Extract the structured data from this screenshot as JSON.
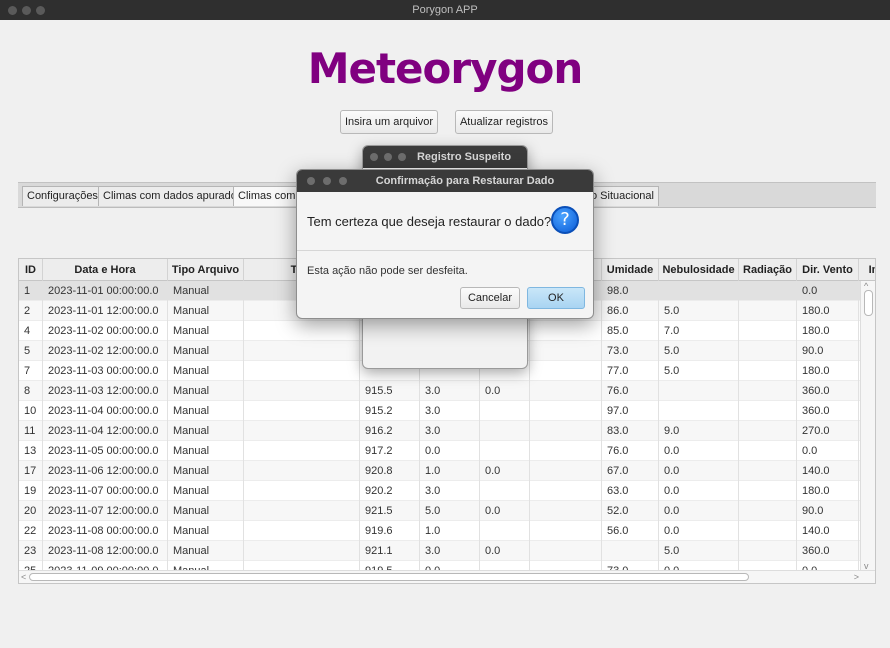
{
  "window": {
    "title": "Porygon APP"
  },
  "app": {
    "title": "Meteorygon"
  },
  "toolbar": {
    "insert_label": "Insira um arquivor",
    "update_label": "Atualizar registros"
  },
  "tabs": [
    {
      "label": "Configurações"
    },
    {
      "label": "Climas com dados apurados"
    },
    {
      "label": "Climas com"
    },
    {
      "label": "o Situacional"
    }
  ],
  "table": {
    "columns": [
      "ID",
      "Data e Hora",
      "Tipo Arquivo",
      "Tem",
      "Umidade",
      "Nebulosidade",
      "Radiação",
      "Dir. Vento",
      "In"
    ],
    "rows": [
      [
        "1",
        "2023-11-01 00:00:00.0",
        "Manual",
        "",
        "",
        "",
        "",
        "98.0",
        "",
        "",
        "0.0"
      ],
      [
        "2",
        "2023-11-01 12:00:00.0",
        "Manual",
        "",
        "",
        "",
        "",
        "86.0",
        "5.0",
        "",
        "180.0"
      ],
      [
        "4",
        "2023-11-02 00:00:00.0",
        "Manual",
        "",
        "",
        "",
        "",
        "85.0",
        "7.0",
        "",
        "180.0"
      ],
      [
        "5",
        "2023-11-02 12:00:00.0",
        "Manual",
        "",
        "",
        "",
        "",
        "73.0",
        "5.0",
        "",
        "90.0"
      ],
      [
        "7",
        "2023-11-03 00:00:00.0",
        "Manual",
        "",
        "",
        "",
        "",
        "77.0",
        "5.0",
        "",
        "180.0"
      ],
      [
        "8",
        "2023-11-03 12:00:00.0",
        "Manual",
        "915.5",
        "3.0",
        "0.0",
        "",
        "76.0",
        "",
        "",
        "360.0"
      ],
      [
        "10",
        "2023-11-04 00:00:00.0",
        "Manual",
        "915.2",
        "3.0",
        "",
        "",
        "97.0",
        "",
        "",
        "360.0"
      ],
      [
        "11",
        "2023-11-04 12:00:00.0",
        "Manual",
        "916.2",
        "3.0",
        "",
        "",
        "83.0",
        "9.0",
        "",
        "270.0"
      ],
      [
        "13",
        "2023-11-05 00:00:00.0",
        "Manual",
        "917.2",
        "0.0",
        "",
        "",
        "76.0",
        "0.0",
        "",
        "0.0"
      ],
      [
        "17",
        "2023-11-06 12:00:00.0",
        "Manual",
        "920.8",
        "1.0",
        "0.0",
        "",
        "67.0",
        "0.0",
        "",
        "140.0"
      ],
      [
        "19",
        "2023-11-07 00:00:00.0",
        "Manual",
        "920.2",
        "3.0",
        "",
        "",
        "63.0",
        "0.0",
        "",
        "180.0"
      ],
      [
        "20",
        "2023-11-07 12:00:00.0",
        "Manual",
        "921.5",
        "5.0",
        "0.0",
        "",
        "52.0",
        "0.0",
        "",
        "90.0"
      ],
      [
        "22",
        "2023-11-08 00:00:00.0",
        "Manual",
        "919.6",
        "1.0",
        "",
        "",
        "56.0",
        "0.0",
        "",
        "140.0"
      ],
      [
        "23",
        "2023-11-08 12:00:00.0",
        "Manual",
        "921.1",
        "3.0",
        "0.0",
        "",
        "",
        "5.0",
        "",
        "360.0"
      ],
      [
        "25",
        "2023-11-09 00:00:00.0",
        "Manual",
        "919.5",
        "0.0",
        "",
        "",
        "73.0",
        "0.0",
        "",
        "0.0"
      ]
    ]
  },
  "dialog_back": {
    "title": "Registro Suspeito"
  },
  "dialog": {
    "title": "Confirmação para Restaurar Dado",
    "question": "Tem certeza que deseja restaurar o dado?",
    "detail": "Esta ação não pode ser desfeita.",
    "cancel_label": "Cancelar",
    "ok_label": "OK",
    "icon_glyph": "?"
  }
}
